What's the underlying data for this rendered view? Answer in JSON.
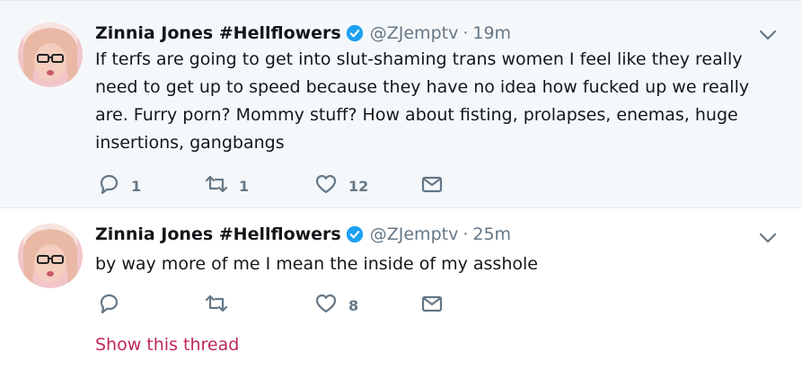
{
  "tweets": [
    {
      "name": "Zinnia Jones #Hellflowers",
      "handle": "@ZJemptv",
      "separator": "·",
      "time": "19m",
      "text": "If terfs are going to get into slut-shaming trans women I feel like they really need to get up to speed because they have no idea how fucked up we really are. Furry porn? Mommy stuff? How about fisting, prolapses, enemas, huge insertions, gangbangs",
      "reply_count": "1",
      "retweet_count": "1",
      "like_count": "12"
    },
    {
      "name": "Zinnia Jones #Hellflowers",
      "handle": "@ZJemptv",
      "separator": "·",
      "time": "25m",
      "text": "by way more of me I mean the inside of my asshole",
      "reply_count": "",
      "retweet_count": "",
      "like_count": "8",
      "show_thread": "Show this thread"
    }
  ],
  "colors": {
    "verified": "#1da1f2",
    "muted": "#657786",
    "link": "#c0265a",
    "highlight_bg": "#f5f8fa"
  },
  "icons": [
    "verified-badge-icon",
    "chevron-down-icon",
    "reply-icon",
    "retweet-icon",
    "like-icon",
    "direct-message-icon"
  ]
}
